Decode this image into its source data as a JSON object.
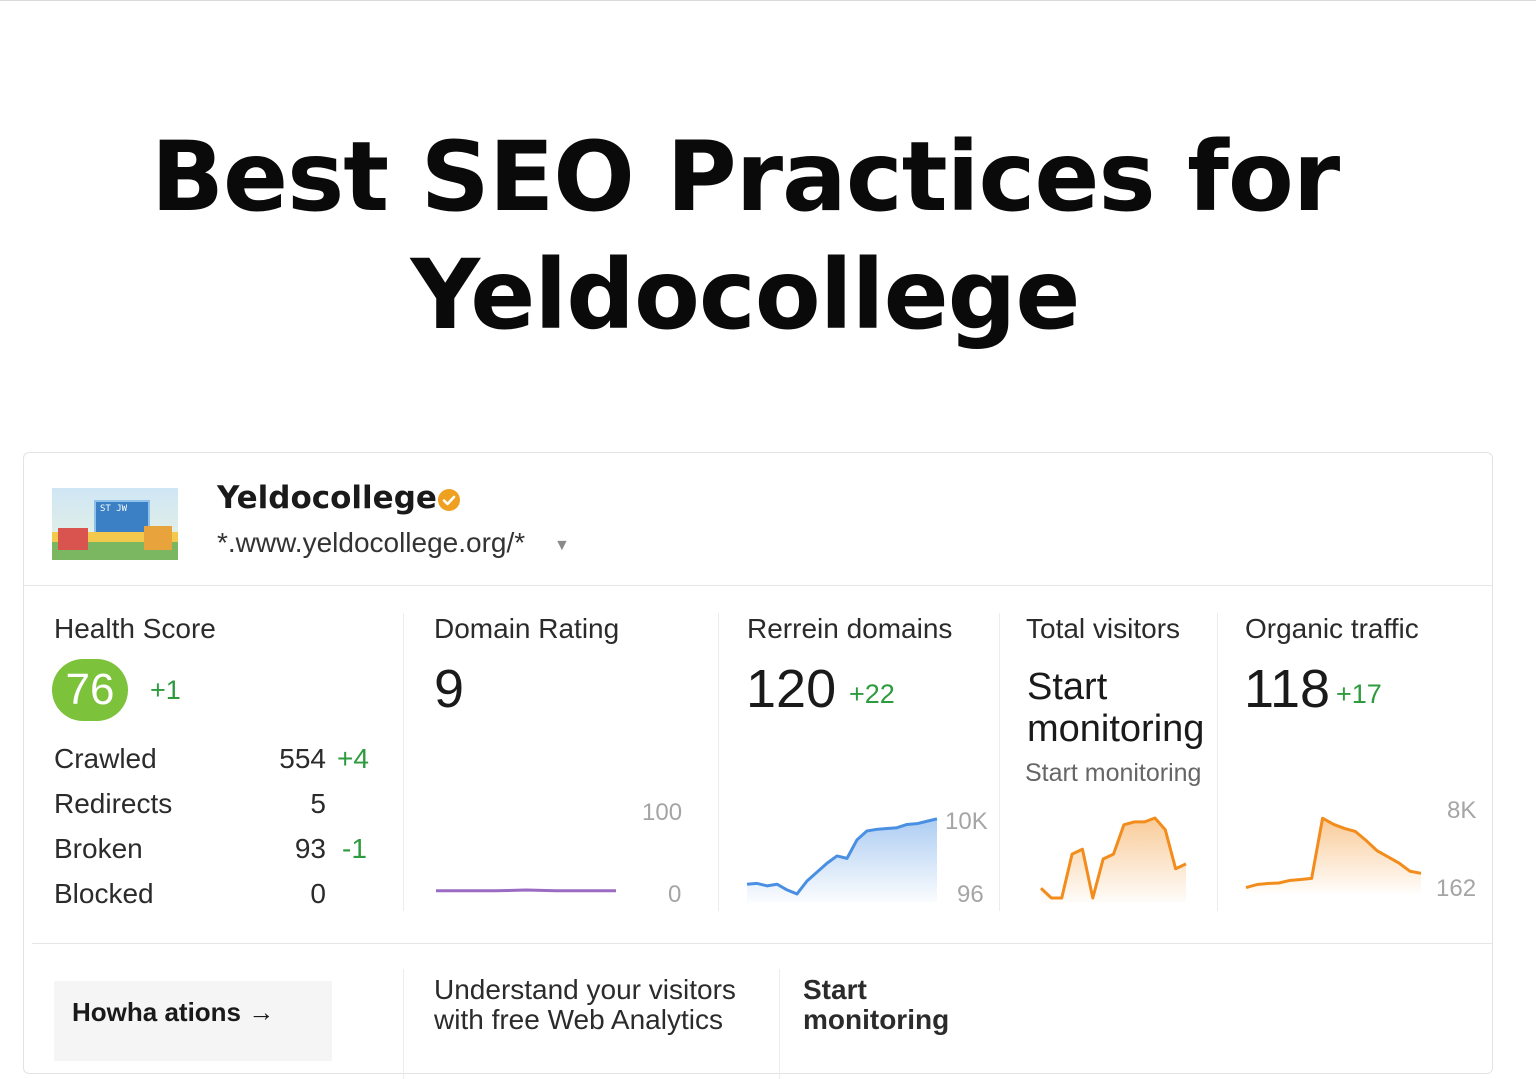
{
  "title": {
    "line1": "Best SEO Practices  for",
    "line2": "Yeldocollege"
  },
  "site": {
    "name": "Yeldocollege",
    "url": "*.www.yeldocollege.org/*",
    "thumbnail_sign_text": "ST JW",
    "verified_color": "#f0a020"
  },
  "metrics": {
    "health": {
      "label": "Health Score",
      "score": "76",
      "delta": "+1",
      "rows": [
        {
          "label": "Crawled",
          "value": "554",
          "delta": "+4"
        },
        {
          "label": "Redirects",
          "value": "5",
          "delta": ""
        },
        {
          "label": "Broken",
          "value": "93",
          "delta": "-1"
        },
        {
          "label": "Blocked",
          "value": "0",
          "delta": ""
        }
      ]
    },
    "domain_rating": {
      "label": "Domain Rating",
      "value": "9",
      "axis_top": "100",
      "axis_bottom": "0"
    },
    "referring_domains": {
      "label": "Rerrein domains",
      "value": "120",
      "delta": "+22",
      "axis_top": "10K",
      "axis_bottom": "96"
    },
    "total_visitors": {
      "label": "Total visitors",
      "cta": "Start monitoring",
      "cta_sub": "Start  monitoring"
    },
    "organic_traffic": {
      "label": "Organic traffic",
      "value": "118",
      "delta": "+17",
      "axis_top": "8K",
      "axis_bottom": "162"
    }
  },
  "lower": {
    "how_text": "Howha ations →",
    "visitors_text": "Understand your visitors with free Web Analytics",
    "start_text": "Start monitoring"
  },
  "colors": {
    "green": "#2e9b3e",
    "health_badge": "#7cc23a",
    "line_purple": "#9b6bc4",
    "line_blue": "#4a90e2",
    "line_orange": "#f28c1c"
  },
  "chart_data": [
    {
      "type": "line",
      "name": "domain-rating-trend",
      "ylim": [
        0,
        100
      ],
      "x": [
        0,
        1,
        2,
        3,
        4,
        5,
        6
      ],
      "values": [
        9,
        9,
        9,
        10,
        9,
        9,
        9
      ]
    },
    {
      "type": "area",
      "name": "referring-domains-trend",
      "ylim": [
        96,
        10000
      ],
      "x": [
        0,
        1,
        2,
        3,
        4,
        5,
        6,
        7,
        8,
        9,
        10,
        11,
        12,
        13,
        14,
        15,
        16,
        17,
        18,
        19
      ],
      "values": [
        1800,
        1900,
        1600,
        1800,
        1100,
        600,
        2200,
        3300,
        4400,
        5300,
        5000,
        7300,
        8400,
        8600,
        8700,
        8800,
        9200,
        9300,
        9600,
        9900
      ]
    },
    {
      "type": "area",
      "name": "total-visitors-trend",
      "x": [
        0,
        1,
        2,
        3,
        4,
        5,
        6,
        7,
        8,
        9,
        10,
        11,
        12,
        13,
        14
      ],
      "values": [
        20,
        10,
        10,
        55,
        60,
        10,
        50,
        55,
        85,
        88,
        88,
        92,
        80,
        40,
        45
      ]
    },
    {
      "type": "area",
      "name": "organic-traffic-trend",
      "ylim": [
        162,
        8000
      ],
      "x": [
        0,
        1,
        2,
        3,
        4,
        5,
        6,
        7,
        8,
        9,
        10,
        11,
        12,
        13,
        14,
        15,
        16
      ],
      "values": [
        200,
        500,
        600,
        650,
        900,
        1000,
        1100,
        7000,
        6400,
        6000,
        5700,
        4800,
        3800,
        3200,
        2600,
        1800,
        1600
      ]
    }
  ]
}
